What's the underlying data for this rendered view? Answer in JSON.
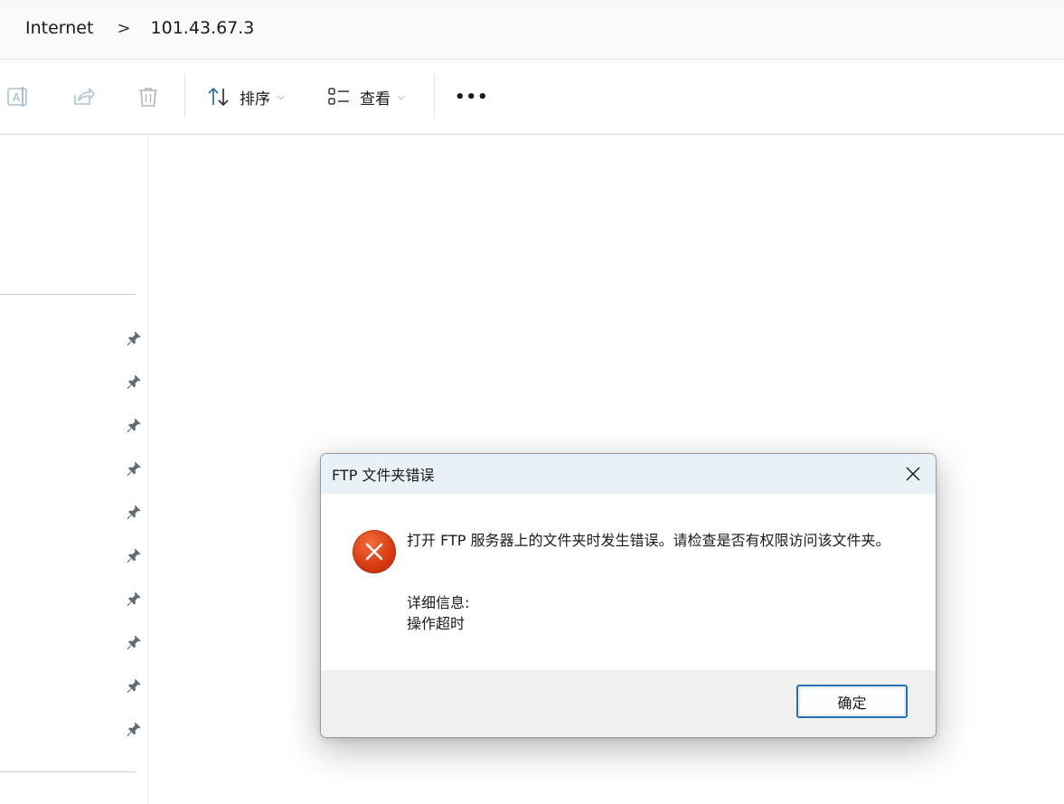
{
  "address_bar": {
    "breadcrumbs": [
      "Internet",
      "101.43.67.3"
    ],
    "separator": ">"
  },
  "toolbar": {
    "rename_icon": "rename-icon",
    "share_icon": "share-icon",
    "delete_icon": "trash-icon",
    "sort_label": "排序",
    "view_label": "查看",
    "more_label": "•••"
  },
  "nav_pane": {
    "pinned_count": 10,
    "pin_icon": "pin-icon"
  },
  "dialog": {
    "title": "FTP 文件夹错误",
    "icon": "error-icon",
    "message": "打开 FTP 服务器上的文件夹时发生错误。请检查是否有权限访问该文件夹。",
    "details_label": "详细信息:",
    "details_value": "操作超时",
    "ok_label": "确定",
    "colors": {
      "title_bar": "#e8f1f5",
      "error_red": "#d63a10",
      "footer": "#f0f0f0",
      "ok_border": "#1f6fb2"
    }
  }
}
